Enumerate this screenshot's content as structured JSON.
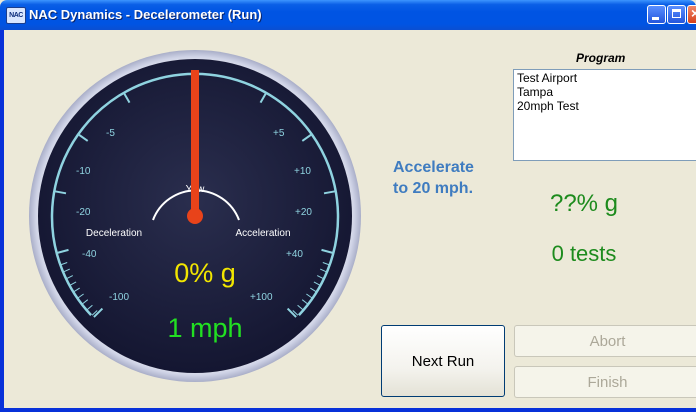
{
  "window": {
    "title": "NAC Dynamics - Decelerometer (Run)",
    "icon_text": "NAC"
  },
  "gauge": {
    "scale_left": [
      "-5",
      "-10",
      "-20",
      "-40",
      "-100"
    ],
    "scale_right": [
      "+5",
      "+10",
      "+20",
      "+40",
      "+100"
    ],
    "yaw_label": "Yaw",
    "deceleration_label": "Deceleration",
    "acceleration_label": "Acceleration",
    "g_value": "0% g",
    "speed": "1 mph",
    "needle_value_percent_g": 0,
    "colors": {
      "face": "#1c1f3a",
      "scale": "#8fd3e0",
      "needle": "#e8431a",
      "g_value": "#f2e600",
      "speed": "#22e022"
    }
  },
  "status": {
    "prompt_line1": "Accelerate",
    "prompt_line2": "to 20 mph.",
    "g_readout": "??% g",
    "tests_readout": "0 tests"
  },
  "program": {
    "label": "Program",
    "items": [
      "Test Airport",
      "Tampa",
      "20mph Test"
    ]
  },
  "buttons": {
    "next_run": "Next Run",
    "abort": "Abort",
    "finish": "Finish"
  }
}
